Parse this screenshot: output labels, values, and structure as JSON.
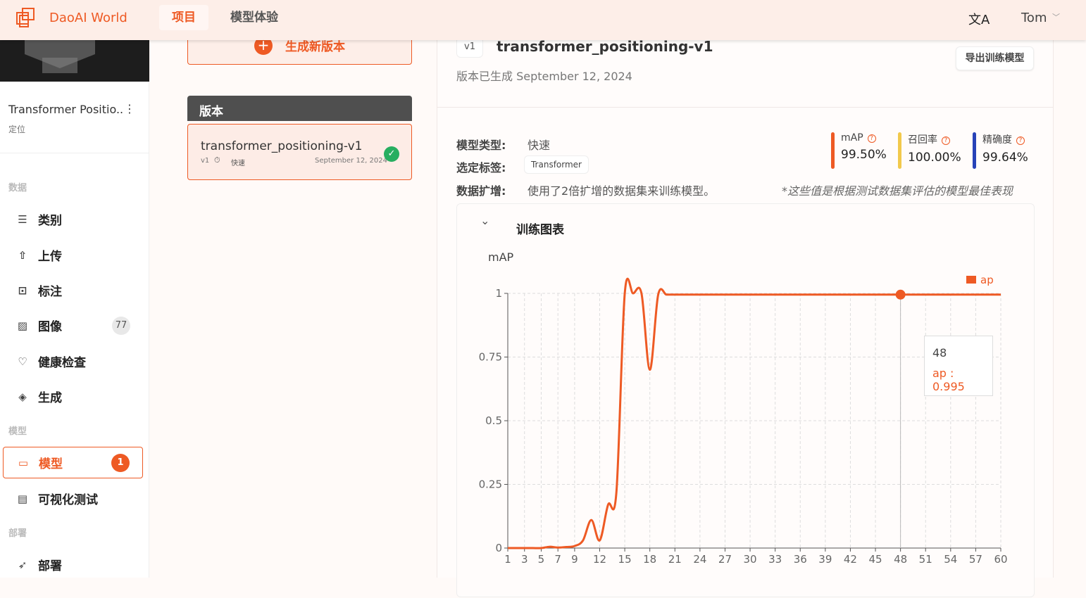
{
  "header": {
    "brand": "DaoAI World",
    "nav": [
      {
        "label": "项目",
        "active": true
      },
      {
        "label": "模型体验",
        "active": false
      }
    ],
    "user": "Tom",
    "icons": [
      "translate-icon",
      "chevron-down-icon"
    ]
  },
  "sidebar": {
    "project_name": "Transformer Positio..",
    "project_type": "定位",
    "sections": [
      {
        "title": "数据",
        "items": [
          {
            "label": "类别",
            "icon": "list-icon"
          },
          {
            "label": "上传",
            "icon": "upload-icon"
          },
          {
            "label": "标注",
            "icon": "annotate-icon"
          },
          {
            "label": "图像",
            "icon": "image-icon",
            "badge": "77"
          },
          {
            "label": "健康检查",
            "icon": "heart-icon"
          },
          {
            "label": "生成",
            "icon": "layers-icon"
          }
        ]
      },
      {
        "title": "模型",
        "items": [
          {
            "label": "模型",
            "icon": "folder-icon",
            "badge": "1",
            "active": true
          },
          {
            "label": "可视化测试",
            "icon": "document-icon"
          }
        ]
      },
      {
        "title": "部署",
        "items": [
          {
            "label": "部署",
            "icon": "rocket-icon"
          }
        ]
      }
    ]
  },
  "versions": {
    "generate_label": "生成新版本",
    "header": "版本",
    "items": [
      {
        "name": "transformer_positioning-v1",
        "tag": "v1",
        "speed": "快速",
        "date": "September 12, 2024",
        "status": "complete"
      }
    ]
  },
  "detail": {
    "version_tag": "v1",
    "title": "transformer_positioning-v1",
    "generated": "版本已生成 September 12, 2024",
    "export_label": "导出训练模型",
    "model_type_label": "模型类型:",
    "model_type": "快速",
    "tag_label": "选定标签:",
    "tag": "Transformer",
    "aug_label": "数据扩增:",
    "aug": "使用了2倍扩增的数据集来训练模型。",
    "note": "*这些值是根据测试数据集评估的模型最佳表现",
    "metrics": [
      {
        "label": "mAP",
        "value": "99.50%",
        "color": "#ee5a24"
      },
      {
        "label": "召回率",
        "value": "100.00%",
        "color": "#f2c94c"
      },
      {
        "label": "精确度",
        "value": "99.64%",
        "color": "#2743b8"
      }
    ],
    "chart_section": "训练图表"
  },
  "chart_data": {
    "type": "line",
    "title": "mAP",
    "legend": [
      "ap"
    ],
    "legend_position": "top-right",
    "color": "#ee5a24",
    "grid": true,
    "x": [
      1,
      2,
      3,
      4,
      5,
      6,
      7,
      8,
      9,
      10,
      11,
      12,
      13,
      14,
      15,
      16,
      17,
      18,
      19,
      20,
      21,
      22,
      23,
      24,
      25,
      26,
      27,
      28,
      29,
      30,
      31,
      32,
      33,
      34,
      35,
      36,
      37,
      38,
      39,
      40,
      41,
      42,
      43,
      44,
      45,
      46,
      47,
      48,
      49,
      50,
      51,
      52,
      53,
      54,
      55,
      56,
      57,
      58,
      59,
      60
    ],
    "x_ticks": [
      1,
      3,
      5,
      7,
      9,
      12,
      15,
      18,
      21,
      24,
      27,
      30,
      33,
      36,
      39,
      42,
      45,
      48,
      51,
      54,
      57,
      60
    ],
    "y_ticks": [
      0,
      0.25,
      0.5,
      0.75,
      1
    ],
    "ylim": [
      0,
      1
    ],
    "xlim": [
      1,
      60
    ],
    "series": [
      {
        "name": "ap",
        "values": [
          0,
          0,
          0,
          0,
          0,
          0.005,
          0.002,
          0.004,
          0.008,
          0.03,
          0.11,
          0.03,
          0.17,
          0.22,
          1,
          1,
          1,
          0.7,
          0.995,
          0.995,
          0.995,
          0.995,
          0.995,
          0.995,
          0.995,
          0.995,
          0.995,
          0.995,
          0.995,
          0.995,
          0.995,
          0.995,
          0.995,
          0.995,
          0.995,
          0.995,
          0.995,
          0.995,
          0.995,
          0.995,
          0.995,
          0.995,
          0.995,
          0.995,
          0.995,
          0.995,
          0.995,
          0.995,
          0.995,
          0.995,
          0.995,
          0.995,
          0.995,
          0.995,
          0.995,
          0.995,
          0.995,
          0.995,
          0.995,
          0.995
        ]
      }
    ],
    "tooltip": {
      "x": "48",
      "text": "ap : 0.995"
    }
  }
}
